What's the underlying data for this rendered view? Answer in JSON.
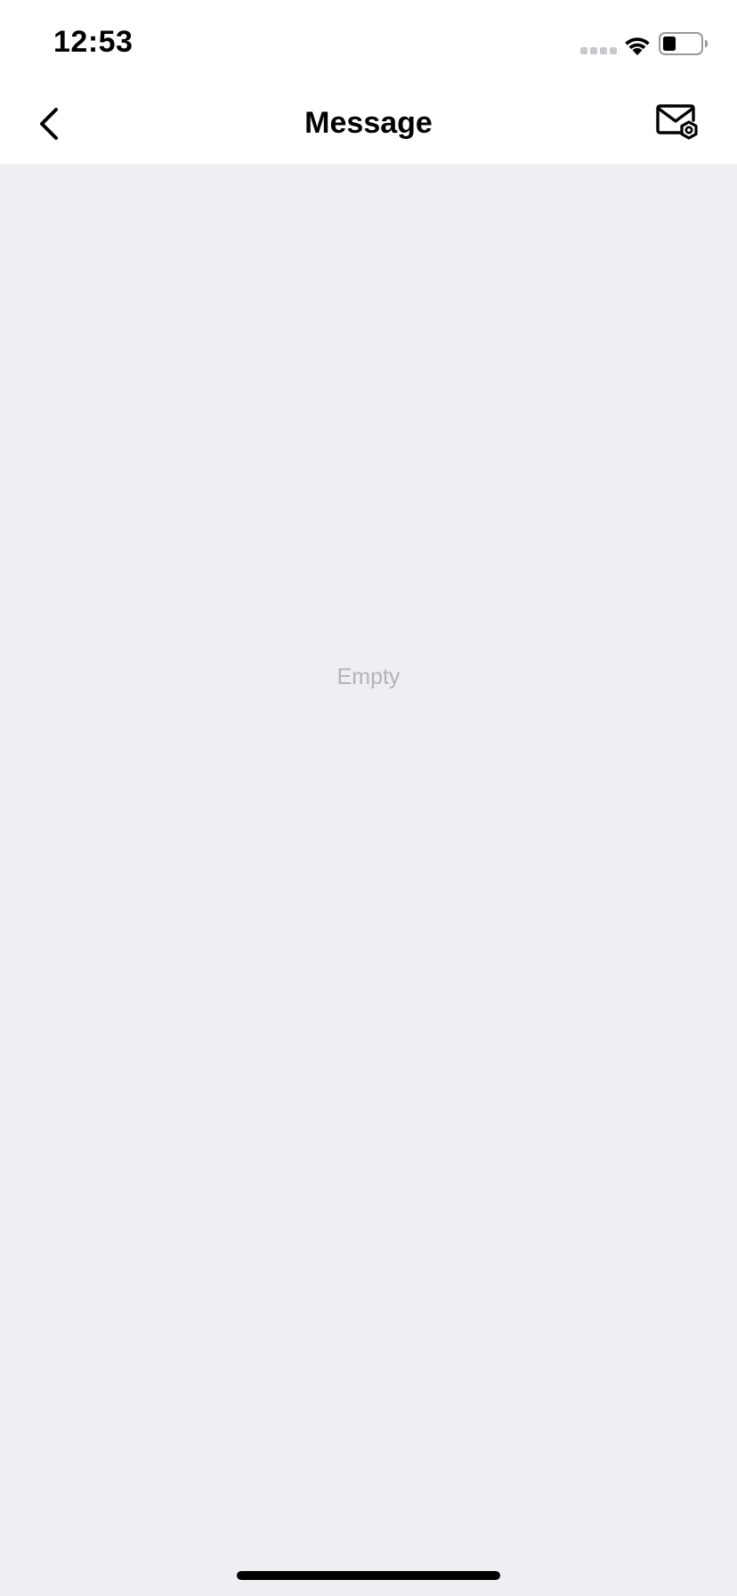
{
  "status_bar": {
    "time": "12:53",
    "icons": [
      "signal-icon",
      "wifi-icon",
      "battery-icon"
    ]
  },
  "nav": {
    "title": "Message",
    "back_icon": "chevron-left-icon",
    "action_icon": "mail-settings-icon"
  },
  "content": {
    "empty_label": "Empty"
  },
  "colors": {
    "background": "#eeeef3",
    "nav_background": "#ffffff",
    "empty_text": "#b2b2b8",
    "title_text": "#000000"
  }
}
